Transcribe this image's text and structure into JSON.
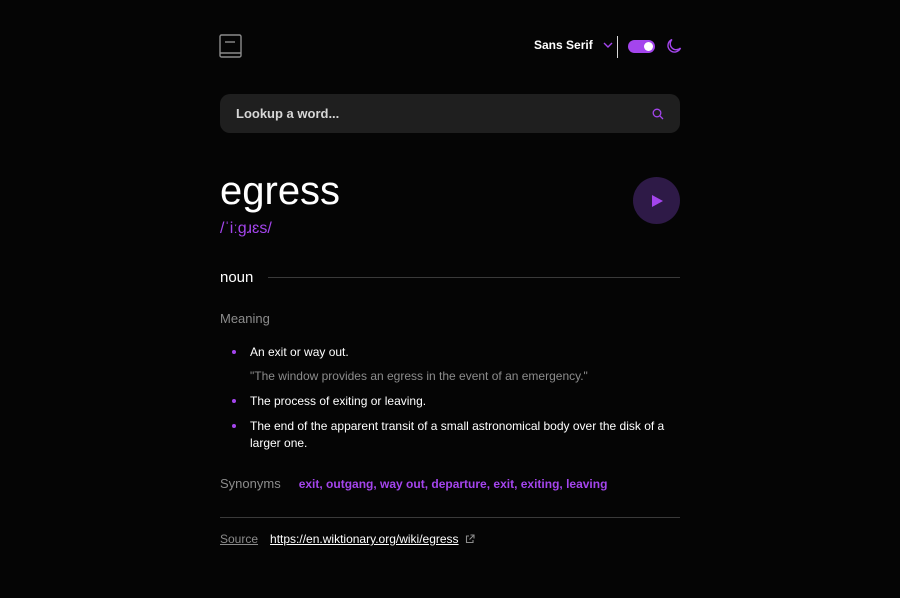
{
  "header": {
    "logo_icon": "book-icon",
    "font_selector": {
      "label": "Sans Serif",
      "icon": "chevron-down-icon"
    },
    "theme_toggle": {
      "state": "on",
      "icon": "moon-icon"
    }
  },
  "search": {
    "placeholder": "Lookup a word...",
    "icon": "search-icon"
  },
  "entry": {
    "word": "egress",
    "phonetic": "/ˈiːɡɹɛs/",
    "play_icon": "play-icon",
    "part_of_speech": "noun",
    "meaning_heading": "Meaning",
    "definitions": [
      {
        "text": "An exit or way out.",
        "example": "\"The window provides an egress in the event of an emergency.\""
      },
      {
        "text": "The process of exiting or leaving."
      },
      {
        "text": "The end of the apparent transit of a small astronomical body over the disk of a larger one."
      }
    ],
    "synonyms_label": "Synonyms",
    "synonyms": "exit, outgang, way out, departure, exit, exiting, leaving"
  },
  "source": {
    "label": "Source",
    "url": "https://en.wiktionary.org/wiki/egress",
    "icon": "external-link-icon"
  },
  "colors": {
    "accent": "#a445ed",
    "background": "#050505",
    "search_bg": "#1f1f1f",
    "muted": "#8c8c8c"
  }
}
